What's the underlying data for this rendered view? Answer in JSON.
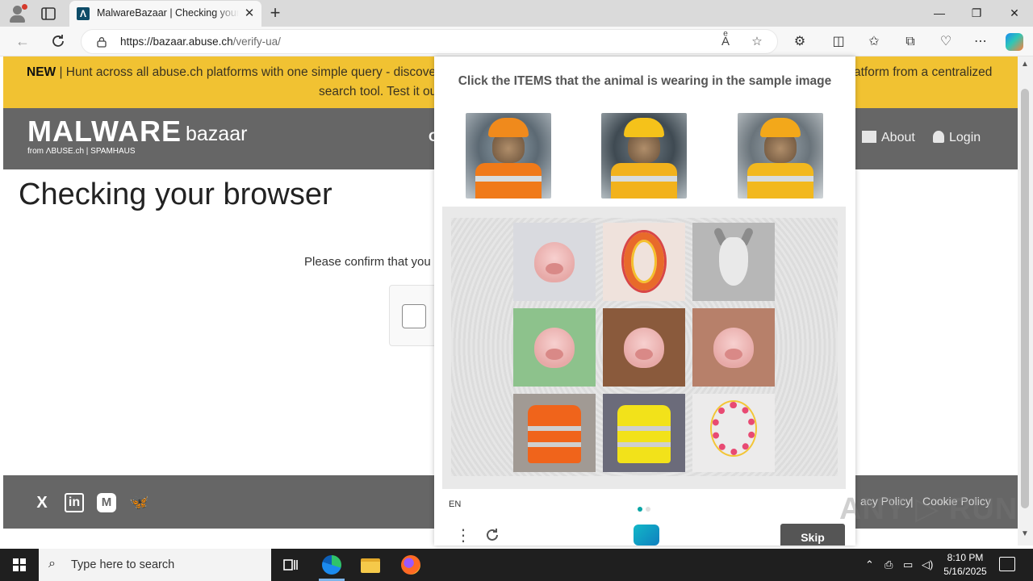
{
  "browser": {
    "tab_title": "MalwareBazaar | Checking your browser",
    "tab_favicon": "Λ",
    "url_host": "https://bazaar.abuse.ch",
    "url_path": "/verify-ua/",
    "new_tab": "+",
    "close_tab": "✕",
    "window_controls": {
      "minimize": "—",
      "maximize": "❐",
      "close": "✕"
    }
  },
  "banner": {
    "new_label": "NEW",
    "line1": " | Hunt across all abuse.ch platforms with one simple query - discove",
    "line1_right": "atform from a centralized",
    "line2": "search tool. Test it ou"
  },
  "header": {
    "logo_main": "MALWARE",
    "logo_sub": "bazaar",
    "logo_from": "from ΛBUSE.ch | SPAMHAUS",
    "peek_letter": "C",
    "nav": [
      {
        "label": "About",
        "icon": "bank-icon"
      },
      {
        "label": "Login",
        "icon": "user-icon"
      }
    ]
  },
  "main": {
    "title": "Checking your browser",
    "confirm_text": "Please confirm that you"
  },
  "footer": {
    "social": [
      "X",
      "in",
      "M",
      "🦋"
    ],
    "links_left": "acy Policy",
    "divider": "|",
    "links_right": "Cookie Policy"
  },
  "captcha": {
    "prompt": "Click the ITEMS that the animal is wearing in the sample image",
    "sample_count": 3,
    "tiles": [
      {
        "name": "pig",
        "bg": "#d9dadf"
      },
      {
        "name": "flower-wreath",
        "bg": "#efe2dc"
      },
      {
        "name": "goat",
        "bg": "#b7b7b7"
      },
      {
        "name": "pig",
        "bg": "#8dc28c"
      },
      {
        "name": "pig",
        "bg": "#8a5a3c"
      },
      {
        "name": "pig",
        "bg": "#b7806a"
      },
      {
        "name": "orange-vest",
        "bg": "#a19a94"
      },
      {
        "name": "yellow-vest",
        "bg": "#6b6b7a"
      },
      {
        "name": "flower-necklace",
        "bg": "#ecebeb"
      }
    ],
    "lang": "EN",
    "skip": "Skip",
    "menu_glyph": "⋮"
  },
  "watermark": "ANY ▷ RUN",
  "taskbar": {
    "search_placeholder": "Type here to search",
    "time": "8:10 PM",
    "date": "5/16/2025"
  },
  "colors": {
    "banner_yellow": "#f1c232",
    "header_grey": "#666666",
    "captcha_skip": "#555555",
    "captcha_accent": "#0aa5a5"
  }
}
